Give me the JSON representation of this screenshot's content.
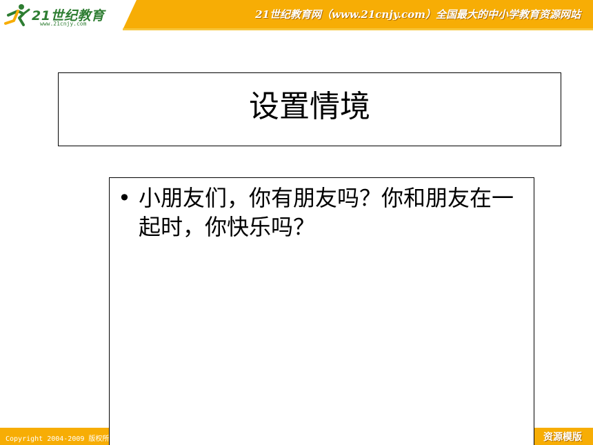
{
  "header": {
    "logo_title": "21世纪教育",
    "logo_url": "www.21cnjy.com",
    "tagline": "21世纪教育网（www.21cnjy.com）全国最大的中小学教育资源网站"
  },
  "slide": {
    "title": "设置情境",
    "bullets": [
      "小朋友们，你有朋友吗？你和朋友在一起时，你快乐吗？"
    ]
  },
  "footer": {
    "copyright": "Copyright 2004-2009 版权所",
    "right_text": "资源模版"
  },
  "colors": {
    "band": "#f7ad05",
    "logo_green": "#2e7d32"
  }
}
